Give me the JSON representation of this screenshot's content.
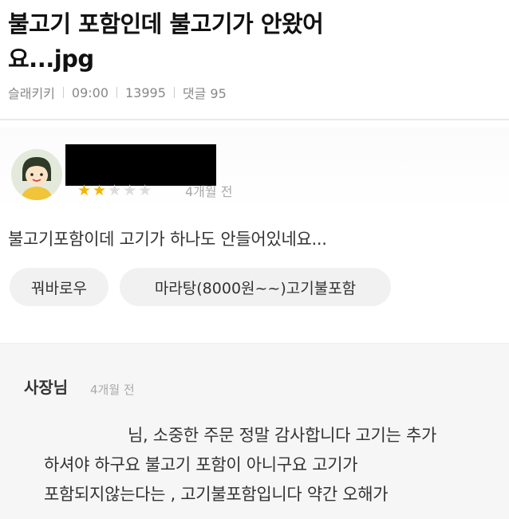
{
  "post": {
    "title_line1": "불고기 포함인데 불고기가 안왔어",
    "title_line2": "요...jpg",
    "author": "슬래키키",
    "time": "09:00",
    "views": "13995",
    "comments": "댓글 95"
  },
  "review": {
    "rating": 2,
    "rating_max": 5,
    "date": "4개월 전",
    "text": "불고기포함이데 고기가 하나도 안들어있네요...",
    "tags": [
      "꿔바로우",
      "마라탕(8000원~~)고기불포함"
    ]
  },
  "owner_reply": {
    "label": "사장님",
    "date": "4개월 전",
    "lines": [
      "님, 소중한 주문 정말 감사합니다  고기는 추가",
      "하셔야 하구요 불고기 포함이 아니구요 고기가",
      "포함되지않는다는 , 고기불포함입니다 약간 오해가"
    ]
  }
}
